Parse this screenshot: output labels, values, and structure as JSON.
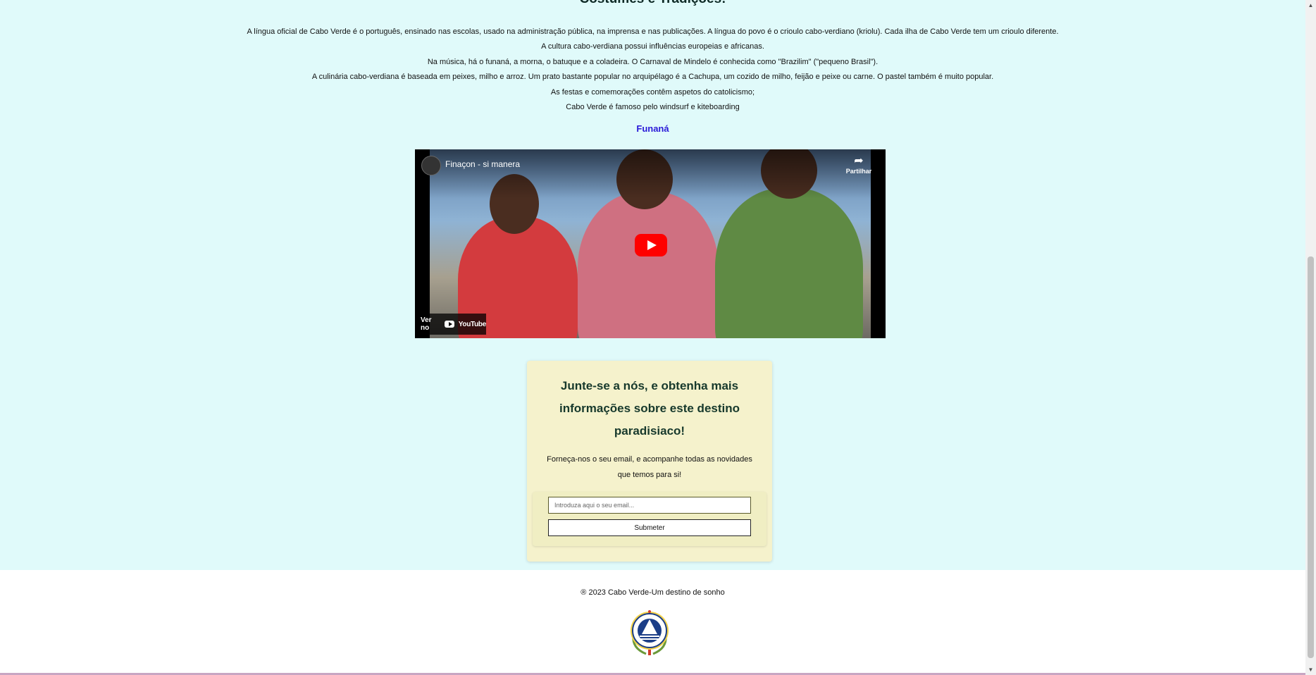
{
  "section": {
    "heading": "Costumes e Tradições:",
    "paragraphs": [
      "A língua oficial de Cabo Verde é o português, ensinado nas escolas, usado na administração pública, na imprensa e nas publicações. A língua do povo é o crioulo cabo-verdiano (kriolu). Cada ilha de Cabo Verde tem um crioulo diferente.",
      "A cultura cabo-verdiana possui influências europeias e africanas.",
      "Na música, há o funaná, a morna, o batuque e a coladeira. O Carnaval de Mindelo é conhecida como \"Brazilim\" (\"pequeno Brasil\").",
      "A culinária cabo-verdiana é baseada em peixes, milho e arroz. Um prato bastante popular no arquipélago é a Cachupa, um cozido de milho, feijão e peixe ou carne. O pastel também é muito popular.",
      "As festas e comemorações contêm aspetos do catolicismo;",
      "Cabo Verde é famoso pelo windsurf e kiteboarding"
    ],
    "subheading": "Funaná"
  },
  "video": {
    "title": "Finaçon - si manera",
    "share_label": "Partilhar",
    "watch_on_label": "Ver no",
    "platform": "YouTube"
  },
  "signup": {
    "title": "Junte-se a nós, e obtenha mais informações sobre este destino paradisiaco!",
    "description": "Forneça-nos o seu email, e acompanhe todas as novidades que temos para si!",
    "email_placeholder": "Introduza aqui o seu email...",
    "submit_label": "Submeter"
  },
  "footer": {
    "copyright": "® 2023 Cabo Verde-Um destino de sonho"
  },
  "colors": {
    "content_bg": "#e0fafa",
    "signup_bg": "#f5f2cc",
    "link_color": "#2a1ad8",
    "heading_color": "#17392c",
    "youtube_red": "#ff0000"
  },
  "icons": [
    "share-icon",
    "play-icon",
    "youtube-logo-icon",
    "cabo-verde-emblem"
  ]
}
